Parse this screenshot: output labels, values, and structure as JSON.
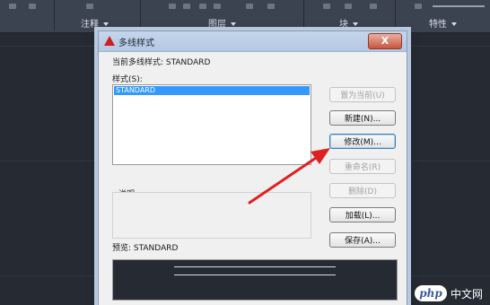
{
  "ribbon": {
    "panels": [
      {
        "label": "注释"
      },
      {
        "label": "图层"
      },
      {
        "label": "块"
      },
      {
        "label": "特性"
      }
    ]
  },
  "dialog": {
    "title": "多线样式",
    "close_label": "X",
    "current_style_label": "当前多线样式: STANDARD",
    "styles_label": "样式(S):",
    "style_items": [
      "STANDARD"
    ],
    "description_label": "说明:",
    "preview_label": "预览: STANDARD",
    "buttons": {
      "set_current": "置为当前(U)",
      "new": "新建(N)...",
      "modify": "修改(M)...",
      "rename": "重命名(R)",
      "delete": "删除(D)",
      "load": "加载(L)...",
      "save": "保存(A)..."
    }
  },
  "watermark": {
    "badge": "php",
    "text": "中文网"
  },
  "colors": {
    "ribbon_bg": "#3b4250",
    "canvas_bg": "#262b33",
    "dialog_bg": "#f0f0f0",
    "selection": "#3399ff",
    "arrow": "#e02020",
    "close_button": "#c7553d"
  }
}
